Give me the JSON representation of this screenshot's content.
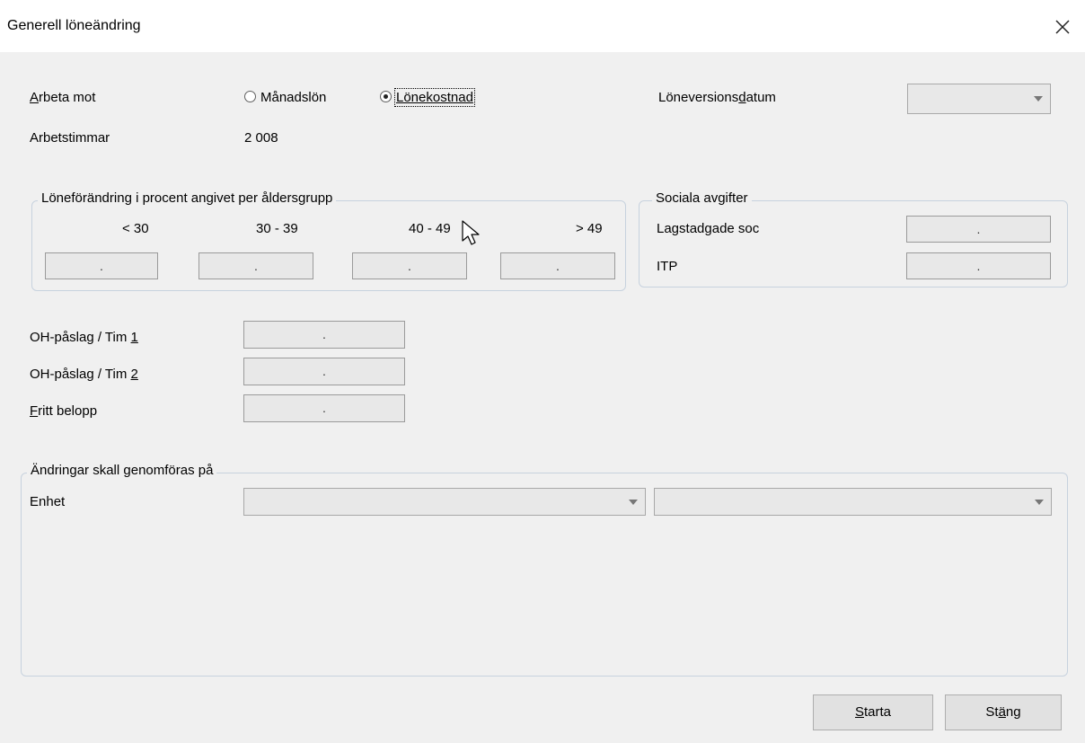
{
  "window": {
    "title": "Generell löneändring",
    "close_glyph": "✕"
  },
  "work": {
    "label_u": "A",
    "label_rest": "rbeta mot",
    "options": [
      {
        "label": "Månadslön",
        "checked": false
      },
      {
        "label": "Lönekostnad",
        "checked": true
      }
    ]
  },
  "hours": {
    "label": "Arbetstimmar",
    "value": "2 008"
  },
  "salary_version": {
    "label_pre": "Löneversions",
    "label_u": "d",
    "label_post": "atum",
    "value": ""
  },
  "age_group": {
    "legend": "Löneförändring i procent angivet per åldersgrupp",
    "headers": [
      "< 30",
      "30 - 39",
      "40 - 49",
      "> 49"
    ],
    "values": [
      ".",
      ".",
      ".",
      "."
    ]
  },
  "social": {
    "legend": "Sociala avgifter",
    "rows": [
      {
        "label": "Lagstadgade soc",
        "value": "."
      },
      {
        "label": "ITP",
        "value": "."
      }
    ]
  },
  "oh1": {
    "label_pre": "OH-påslag / Tim ",
    "label_u": "1",
    "value": "."
  },
  "oh2": {
    "label_pre": "OH-påslag / Tim ",
    "label_u": "2",
    "value": "."
  },
  "free": {
    "label_u": "F",
    "label_rest": "ritt belopp",
    "value": "."
  },
  "changes": {
    "legend": "Ändringar skall genomföras på",
    "unit_label": "Enhet",
    "unit_value": "",
    "unit_value2": ""
  },
  "buttons": {
    "start": {
      "u": "S",
      "rest": "tarta"
    },
    "close": {
      "pre": "St",
      "u": "ä",
      "post": "ng"
    }
  }
}
